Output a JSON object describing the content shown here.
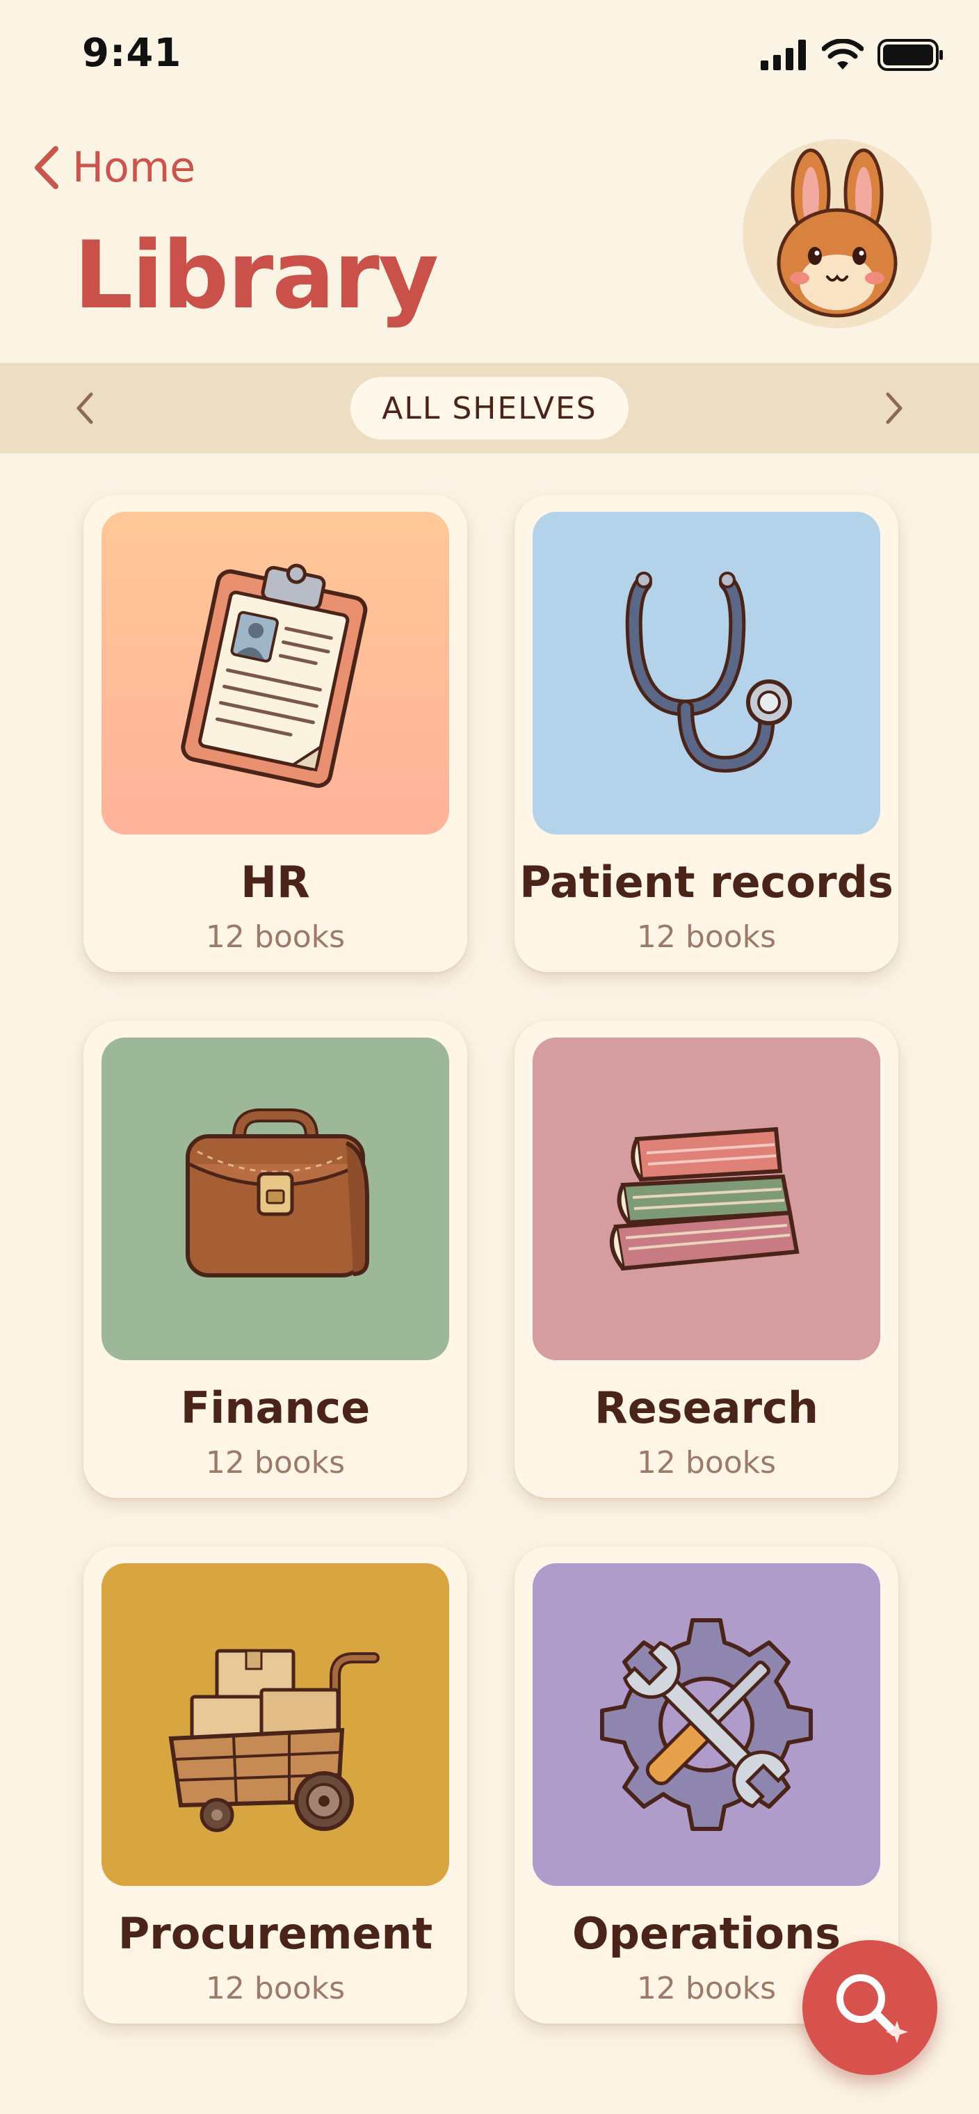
{
  "status_bar": {
    "time": "9:41"
  },
  "header": {
    "back_label": "Home",
    "title": "Library"
  },
  "shelf_nav": {
    "label": "ALL SHELVES"
  },
  "shelves": [
    {
      "name": "HR",
      "count": "12 books",
      "icon": "clipboard-icon",
      "color": "#FFB99A"
    },
    {
      "name": "Patient records",
      "count": "12 books",
      "icon": "stethoscope-icon",
      "color": "#B4D3EA"
    },
    {
      "name": "Finance",
      "count": "12 books",
      "icon": "briefcase-icon",
      "color": "#9DB898"
    },
    {
      "name": "Research",
      "count": "12 books",
      "icon": "book-stack-icon",
      "color": "#D69DA0"
    },
    {
      "name": "Procurement",
      "count": "12 books",
      "icon": "cart-icon",
      "color": "#D8A640"
    },
    {
      "name": "Operations",
      "count": "12 books",
      "icon": "wrench-gear-icon",
      "color": "#AF9CCB"
    }
  ],
  "colors": {
    "accent": "#C9514A",
    "background": "#FBF3E4",
    "band": "#EDDDC2"
  }
}
